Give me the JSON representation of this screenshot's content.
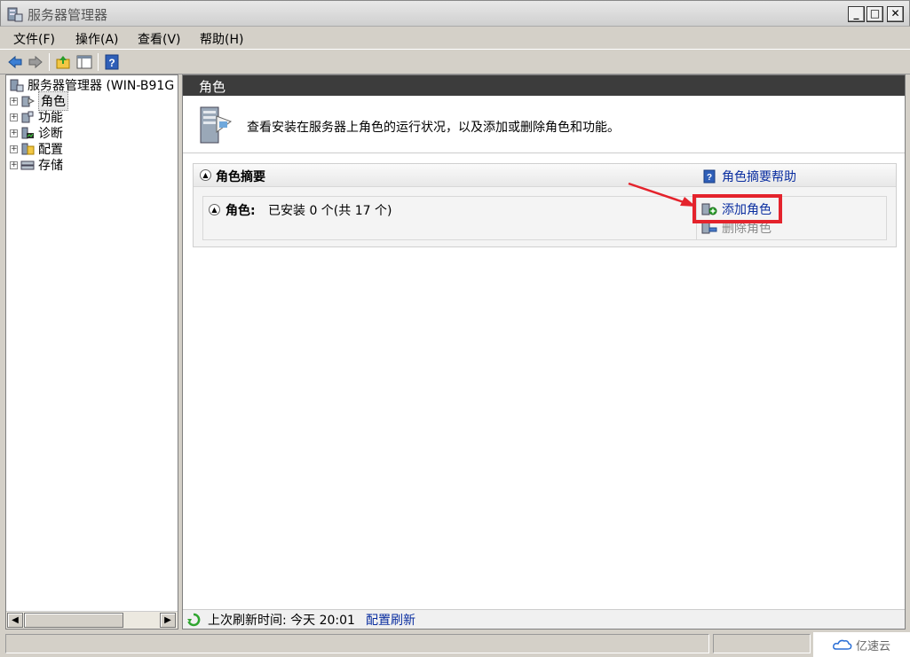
{
  "window": {
    "title": "服务器管理器",
    "min": "_",
    "max": "□",
    "close": "✕"
  },
  "menu": [
    "文件(F)",
    "操作(A)",
    "查看(V)",
    "帮助(H)"
  ],
  "toolbar": {
    "icons": [
      "back-icon",
      "forward-icon",
      "up-level-icon",
      "show-hide-tree-icon",
      "help-icon"
    ]
  },
  "tree": {
    "root": "服务器管理器 (WIN-B91G",
    "items": [
      {
        "label": "角色",
        "icon": "roles-icon",
        "selected": true
      },
      {
        "label": "功能",
        "icon": "features-icon"
      },
      {
        "label": "诊断",
        "icon": "diagnostics-icon"
      },
      {
        "label": "配置",
        "icon": "configuration-icon"
      },
      {
        "label": "存储",
        "icon": "storage-icon"
      }
    ],
    "expander": "+"
  },
  "content": {
    "header": "角色",
    "description": "查看安装在服务器上角色的运行状况，以及添加或删除角色和功能。",
    "section": {
      "title": "角色摘要",
      "help_link": "角色摘要帮助",
      "roles_label": "角色:",
      "roles_value": "已安装 0 个(共 17 个)",
      "actions": {
        "add": "添加角色",
        "remove": "删除角色"
      }
    },
    "status": {
      "last_refresh": "上次刷新时间: 今天 20:01",
      "configure_refresh": "配置刷新"
    }
  },
  "watermark": "亿速云",
  "colors": {
    "header_bg": "#3c3c3c",
    "link": "#0a2ea0",
    "highlight": "#e4232c"
  }
}
